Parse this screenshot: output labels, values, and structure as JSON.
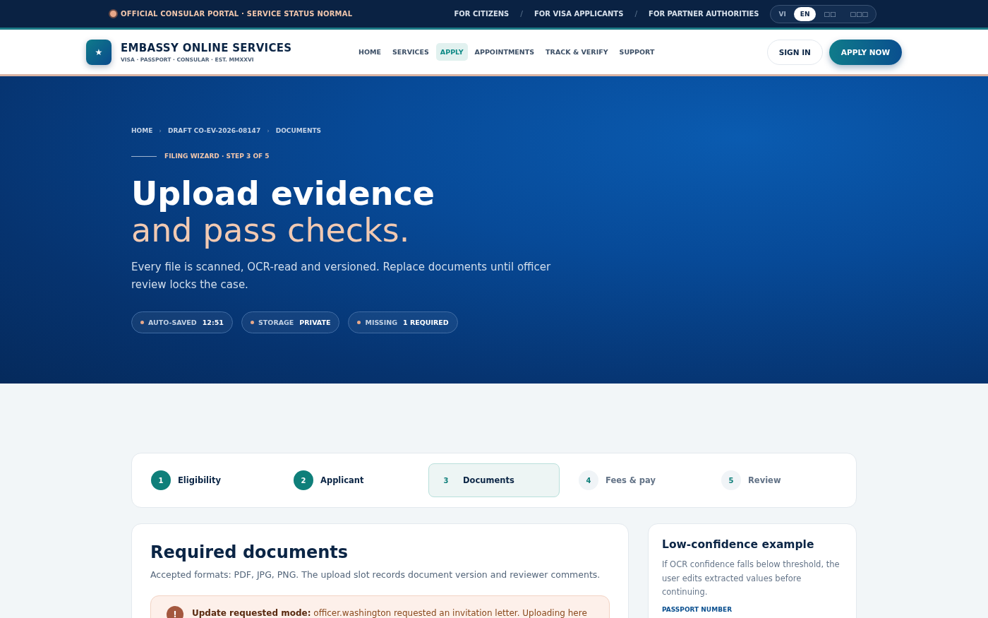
{
  "topbar": {
    "notice": "OFFICIAL CONSULAR PORTAL · SERVICE STATUS NORMAL",
    "audiences": [
      "FOR CITIZENS",
      "FOR VISA APPLICANTS",
      "FOR PARTNER AUTHORITIES"
    ],
    "separator": "/",
    "languages": [
      {
        "label": "VI",
        "selected": false
      },
      {
        "label": "EN",
        "selected": true
      },
      {
        "label": "□□",
        "selected": false
      },
      {
        "label": "□□□",
        "selected": false
      }
    ]
  },
  "header": {
    "logo_mark": "★",
    "brand": "EMBASSY ONLINE SERVICES",
    "tagline": "VISA · PASSPORT · CONSULAR · EST. MMXXVI",
    "nav": [
      {
        "label": "HOME",
        "selected": false
      },
      {
        "label": "SERVICES",
        "selected": false
      },
      {
        "label": "APPLY",
        "selected": true
      },
      {
        "label": "APPOINTMENTS",
        "selected": false
      },
      {
        "label": "TRACK & VERIFY",
        "selected": false
      },
      {
        "label": "SUPPORT",
        "selected": false
      }
    ],
    "sign_in": "SIGN IN",
    "apply_now": "APPLY NOW"
  },
  "hero": {
    "breadcrumb": [
      "HOME",
      "DRAFT CO-EV-2026-08147",
      "DOCUMENTS"
    ],
    "breadcrumb_separator": "›",
    "eyebrow": "FILING WIZARD · STEP 3 OF 5",
    "title_line_1": "Upload evidence",
    "title_line_2": "and pass checks.",
    "lead": "Every file is scanned, OCR-read and versioned. Replace documents until officer review locks the case.",
    "chips": [
      {
        "label": "AUTO-SAVED",
        "value": "12:51"
      },
      {
        "label": "STORAGE",
        "value": "PRIVATE"
      },
      {
        "label": "MISSING",
        "value": "1 REQUIRED"
      }
    ]
  },
  "steps": [
    {
      "number": "1",
      "label": "Eligibility",
      "completed": true,
      "selected": false
    },
    {
      "number": "2",
      "label": "Applicant",
      "completed": true,
      "selected": false
    },
    {
      "number": "3",
      "label": "Documents",
      "completed": false,
      "selected": true
    },
    {
      "number": "4",
      "label": "Fees & pay",
      "completed": false,
      "selected": false
    },
    {
      "number": "5",
      "label": "Review",
      "completed": false,
      "selected": false
    }
  ],
  "documents": {
    "title": "Required documents",
    "subtitle": "Accepted formats: PDF, JPG, PNG. The upload slot records document version and reviewer comments.",
    "alert": {
      "icon": "!",
      "text": "**Update requested mode:** officer.washington requested an invitation letter. Uploading here"
    }
  },
  "side_card": {
    "title": "Low-confidence example",
    "text": "If OCR confidence falls below threshold, the user edits extracted values before continuing.",
    "field_label": "PASSPORT NUMBER"
  }
}
